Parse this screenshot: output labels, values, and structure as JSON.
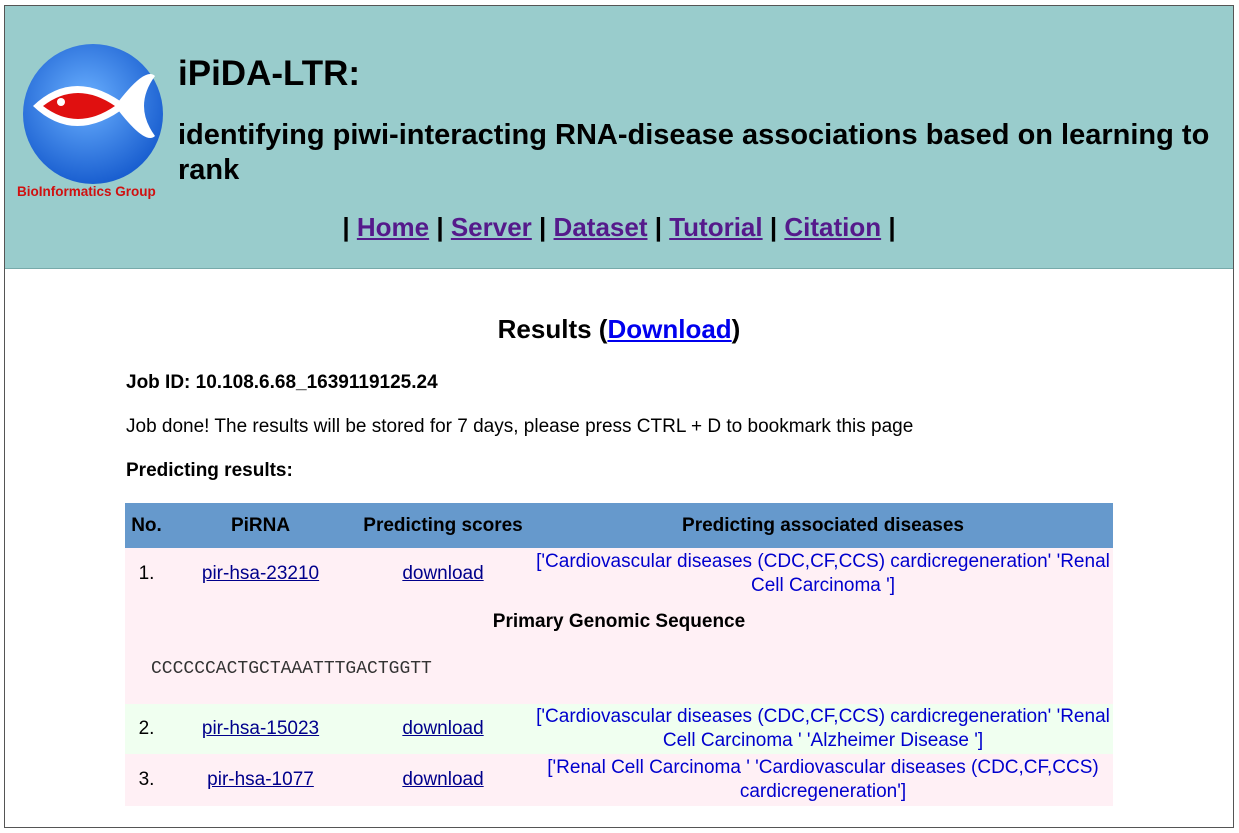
{
  "header": {
    "logo_text": "BioInformatics Group",
    "title": "iPiDA-LTR:",
    "subtitle": "identifying piwi-interacting RNA-disease associations based on learning to rank"
  },
  "nav": {
    "items": [
      "Home",
      "Server",
      "Dataset",
      "Tutorial",
      "Citation"
    ]
  },
  "results": {
    "title_prefix": "Results (",
    "download_label": "Download",
    "title_suffix": ")",
    "job_id": "Job ID: 10.108.6.68_1639119125.24",
    "job_message": "Job done! The results will be stored for 7 days, please press CTRL + D to bookmark this page",
    "predicting_label": "Predicting results:"
  },
  "table": {
    "headers": [
      "No.",
      "PiRNA",
      "Predicting scores",
      "Predicting associated diseases"
    ],
    "rows": [
      {
        "no": "1.",
        "pirna": "pir-hsa-23210",
        "scores": "download",
        "diseases": "['Cardiovascular diseases (CDC,CF,CCS) cardicregeneration' 'Renal Cell Carcinoma ']"
      },
      {
        "no": "2.",
        "pirna": "pir-hsa-15023",
        "scores": "download",
        "diseases": "['Cardiovascular diseases (CDC,CF,CCS) cardicregeneration' 'Renal Cell Carcinoma ' 'Alzheimer Disease ']"
      },
      {
        "no": "3.",
        "pirna": "pir-hsa-1077",
        "scores": "download",
        "diseases": "['Renal Cell Carcinoma ' 'Cardiovascular diseases (CDC,CF,CCS) cardicregeneration']"
      }
    ],
    "sequence_heading": "Primary Genomic Sequence",
    "sequence": "CCCCCCACTGCTAAATTTGACTGGTT"
  },
  "colors": {
    "header_bg": "#99cccc",
    "table_header_bg": "#6699cc",
    "row_pink": "#fff0f5",
    "row_green": "#f0fff0"
  }
}
